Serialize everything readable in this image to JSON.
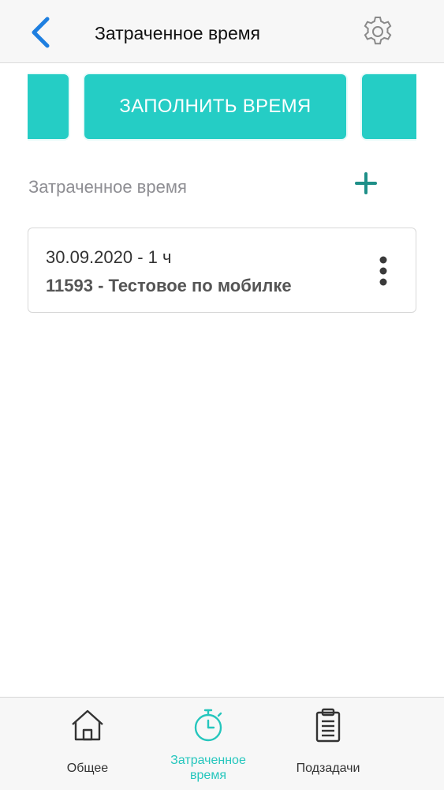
{
  "header": {
    "title": "Затраченное время"
  },
  "actions": {
    "fill_time_label": "ЗАПОЛНИТЬ ВРЕМЯ"
  },
  "section": {
    "label": "Затраченное время"
  },
  "entries": [
    {
      "date_duration": "30.09.2020 - 1 ч",
      "task": "11593 - Тестовое по мобилке"
    }
  ],
  "tabbar": {
    "tabs": [
      {
        "label": "Общее",
        "active": false
      },
      {
        "label_line1": "Затраченное",
        "label_line2": "время",
        "active": true
      },
      {
        "label": "Подзадачи",
        "active": false
      }
    ]
  },
  "colors": {
    "accent": "#25cdc5",
    "add_icon": "#1e8f88",
    "back_icon": "#1e7fe0",
    "active_tab": "#25c6bd"
  }
}
